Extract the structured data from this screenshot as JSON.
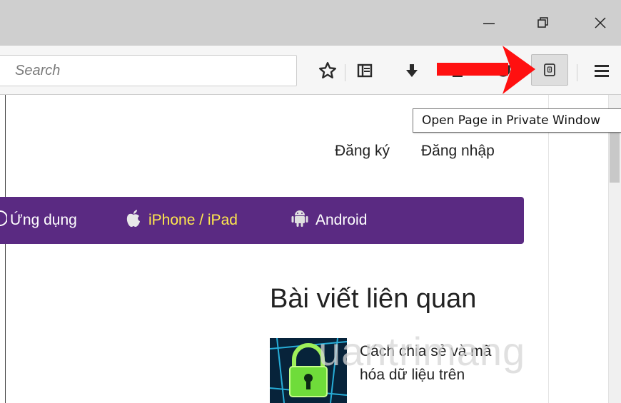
{
  "window": {
    "minimize_icon": "minimize-icon",
    "restore_icon": "restore-icon",
    "close_icon": "close-icon"
  },
  "toolbar": {
    "search_placeholder": "Search",
    "icons": [
      "star-icon",
      "reading-list-icon",
      "download-icon",
      "home-icon",
      "pocket-icon",
      "private-window-icon",
      "menu-icon"
    ]
  },
  "tooltip": {
    "text": "Open Page in Private Window"
  },
  "page": {
    "auth": {
      "register": "Đăng ký",
      "login": "Đăng nhập"
    },
    "nav": [
      {
        "label": "Ứng dụng",
        "icon": "apps-icon",
        "color": "#ffffff"
      },
      {
        "label": "iPhone / iPad",
        "icon": "apple-icon",
        "color": "#ffe84d"
      },
      {
        "label": "Android",
        "icon": "android-icon",
        "color": "#ffffff"
      }
    ],
    "nav_bg": "#5a2a82",
    "related": {
      "title": "Bài viết liên quan",
      "article_lines": [
        "Cách chia sẻ và mã",
        "hóa dữ liệu trên"
      ]
    },
    "watermark": "uantrimang"
  },
  "colors": {
    "arrow": "#ff1010",
    "titlebar": "#cfcfcf"
  }
}
